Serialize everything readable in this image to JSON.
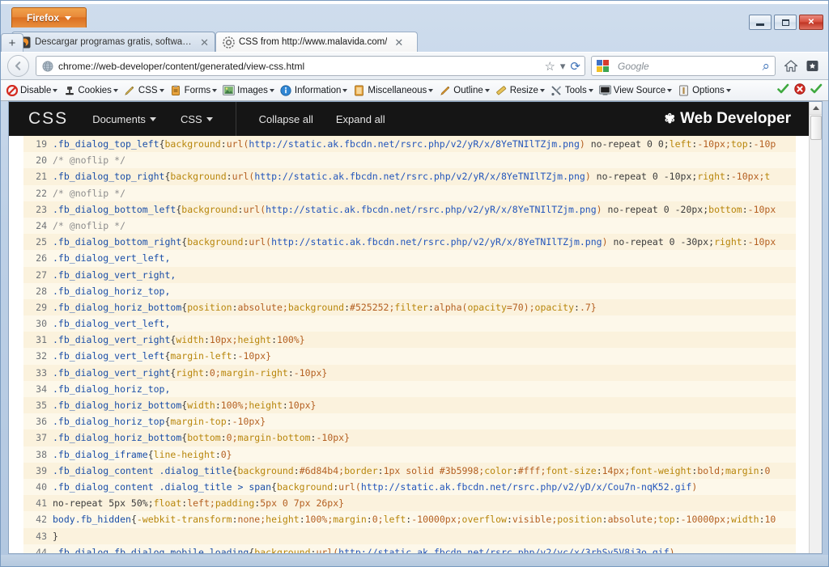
{
  "window": {
    "app_button": "Firefox",
    "controls": {
      "minimize": "minimize-icon",
      "maximize": "maximize-icon",
      "close": "✕"
    }
  },
  "tabs": [
    {
      "title": "Descargar programas gratis, software ...",
      "favicon": "firefox-favicon",
      "close": "✕",
      "active": false
    },
    {
      "title": "CSS from http://www.malavida.com/",
      "favicon": "gear-favicon",
      "close": "✕",
      "active": true
    }
  ],
  "newtab_label": "+",
  "navbar": {
    "back_glyph": "‹",
    "url": "chrome://web-developer/content/generated/view-css.html",
    "site_icon": "globe-icon",
    "star_icon": "☆",
    "dropmarker_icon": "▾",
    "reload_icon": "⟳",
    "search_engine": "Google",
    "search_glyph": "⌕",
    "home_icon": "home-icon",
    "bookmarks_icon": "bookmarks-icon",
    "bookmarks_caret": "▾"
  },
  "wd_toolbar": {
    "items": [
      {
        "label": "Disable",
        "icon": "disable-icon",
        "caret": "▾"
      },
      {
        "label": "Cookies",
        "icon": "cookies-icon",
        "caret": "▾"
      },
      {
        "label": "CSS",
        "icon": "css-pencil-icon",
        "caret": "▾"
      },
      {
        "label": "Forms",
        "icon": "forms-icon",
        "caret": "▾"
      },
      {
        "label": "Images",
        "icon": "images-icon",
        "caret": "▾"
      },
      {
        "label": "Information",
        "icon": "information-icon",
        "caret": "▾"
      },
      {
        "label": "Miscellaneous",
        "icon": "miscellaneous-icon",
        "caret": "▾"
      },
      {
        "label": "Outline",
        "icon": "outline-pencil-icon",
        "caret": "▾"
      },
      {
        "label": "Resize",
        "icon": "resize-ruler-icon",
        "caret": "▾"
      },
      {
        "label": "Tools",
        "icon": "tools-icon",
        "caret": "▾"
      },
      {
        "label": "View Source",
        "icon": "view-source-icon",
        "caret": "▾"
      },
      {
        "label": "Options",
        "icon": "options-icon",
        "caret": "▾"
      }
    ],
    "status": [
      {
        "icon": "validate-check-icon",
        "state": "ok"
      },
      {
        "icon": "validate-error-icon",
        "state": "error"
      },
      {
        "icon": "validate-check-icon",
        "state": "ok"
      }
    ]
  },
  "css_page": {
    "brand": "CSS",
    "menus": [
      {
        "label": "Documents",
        "caret": "▾"
      },
      {
        "label": "CSS",
        "caret": "▾"
      }
    ],
    "links": [
      "Collapse all",
      "Expand all"
    ],
    "wd_title": "Web Developer",
    "wd_gear": "✾"
  },
  "code": {
    "lines": [
      {
        "n": "19",
        "parts": [
          {
            "t": ".fb_dialog_top_left",
            "c": "sel"
          },
          {
            "t": "{",
            "c": "punct"
          },
          {
            "t": "background",
            "c": "prop"
          },
          {
            "t": ":",
            "c": "punct"
          },
          {
            "t": "url(",
            "c": "val"
          },
          {
            "t": "http://static.ak.fbcdn.net/rsrc.php/v2/yR/x/8YeTNIlTZjm.png",
            "c": "url"
          },
          {
            "t": ")",
            "c": "val"
          },
          {
            "t": " no-repeat 0 0;",
            "c": "punct"
          },
          {
            "t": "left",
            "c": "prop"
          },
          {
            "t": ":",
            "c": "punct"
          },
          {
            "t": "-10px;",
            "c": "val"
          },
          {
            "t": "top",
            "c": "prop"
          },
          {
            "t": ":",
            "c": "punct"
          },
          {
            "t": "-10p",
            "c": "val"
          }
        ]
      },
      {
        "n": "20",
        "parts": [
          {
            "t": "/* @noflip */",
            "c": "cmt"
          }
        ]
      },
      {
        "n": "21",
        "parts": [
          {
            "t": ".fb_dialog_top_right",
            "c": "sel"
          },
          {
            "t": "{",
            "c": "punct"
          },
          {
            "t": "background",
            "c": "prop"
          },
          {
            "t": ":",
            "c": "punct"
          },
          {
            "t": "url(",
            "c": "val"
          },
          {
            "t": "http://static.ak.fbcdn.net/rsrc.php/v2/yR/x/8YeTNIlTZjm.png",
            "c": "url"
          },
          {
            "t": ")",
            "c": "val"
          },
          {
            "t": " no-repeat 0 -10px;",
            "c": "punct"
          },
          {
            "t": "right",
            "c": "prop"
          },
          {
            "t": ":",
            "c": "punct"
          },
          {
            "t": "-10px;",
            "c": "val"
          },
          {
            "t": "t",
            "c": "prop"
          }
        ]
      },
      {
        "n": "22",
        "parts": [
          {
            "t": "/* @noflip */",
            "c": "cmt"
          }
        ]
      },
      {
        "n": "23",
        "parts": [
          {
            "t": ".fb_dialog_bottom_left",
            "c": "sel"
          },
          {
            "t": "{",
            "c": "punct"
          },
          {
            "t": "background",
            "c": "prop"
          },
          {
            "t": ":",
            "c": "punct"
          },
          {
            "t": "url(",
            "c": "val"
          },
          {
            "t": "http://static.ak.fbcdn.net/rsrc.php/v2/yR/x/8YeTNIlTZjm.png",
            "c": "url"
          },
          {
            "t": ")",
            "c": "val"
          },
          {
            "t": " no-repeat 0 -20px;",
            "c": "punct"
          },
          {
            "t": "bottom",
            "c": "prop"
          },
          {
            "t": ":",
            "c": "punct"
          },
          {
            "t": "-10px",
            "c": "val"
          }
        ]
      },
      {
        "n": "24",
        "parts": [
          {
            "t": "/* @noflip */",
            "c": "cmt"
          }
        ]
      },
      {
        "n": "25",
        "parts": [
          {
            "t": ".fb_dialog_bottom_right",
            "c": "sel"
          },
          {
            "t": "{",
            "c": "punct"
          },
          {
            "t": "background",
            "c": "prop"
          },
          {
            "t": ":",
            "c": "punct"
          },
          {
            "t": "url(",
            "c": "val"
          },
          {
            "t": "http://static.ak.fbcdn.net/rsrc.php/v2/yR/x/8YeTNIlTZjm.png",
            "c": "url"
          },
          {
            "t": ")",
            "c": "val"
          },
          {
            "t": " no-repeat 0 -30px;",
            "c": "punct"
          },
          {
            "t": "right",
            "c": "prop"
          },
          {
            "t": ":",
            "c": "punct"
          },
          {
            "t": "-10px",
            "c": "val"
          }
        ]
      },
      {
        "n": "26",
        "parts": [
          {
            "t": ".fb_dialog_vert_left,",
            "c": "sel"
          }
        ]
      },
      {
        "n": "27",
        "parts": [
          {
            "t": ".fb_dialog_vert_right,",
            "c": "sel"
          }
        ]
      },
      {
        "n": "28",
        "parts": [
          {
            "t": ".fb_dialog_horiz_top,",
            "c": "sel"
          }
        ]
      },
      {
        "n": "29",
        "parts": [
          {
            "t": ".fb_dialog_horiz_bottom",
            "c": "sel"
          },
          {
            "t": "{",
            "c": "punct"
          },
          {
            "t": "position",
            "c": "prop"
          },
          {
            "t": ":",
            "c": "punct"
          },
          {
            "t": "absolute;",
            "c": "val"
          },
          {
            "t": "background",
            "c": "prop"
          },
          {
            "t": ":",
            "c": "punct"
          },
          {
            "t": "#525252;",
            "c": "val"
          },
          {
            "t": "filter",
            "c": "prop"
          },
          {
            "t": ":",
            "c": "punct"
          },
          {
            "t": "alpha(",
            "c": "val"
          },
          {
            "t": "opacity",
            "c": "prop"
          },
          {
            "t": "=70);",
            "c": "val"
          },
          {
            "t": "opacity",
            "c": "prop"
          },
          {
            "t": ":",
            "c": "punct"
          },
          {
            "t": ".7}",
            "c": "val"
          }
        ]
      },
      {
        "n": "30",
        "parts": [
          {
            "t": ".fb_dialog_vert_left,",
            "c": "sel"
          }
        ]
      },
      {
        "n": "31",
        "parts": [
          {
            "t": ".fb_dialog_vert_right",
            "c": "sel"
          },
          {
            "t": "{",
            "c": "punct"
          },
          {
            "t": "width",
            "c": "prop"
          },
          {
            "t": ":",
            "c": "punct"
          },
          {
            "t": "10px;",
            "c": "val"
          },
          {
            "t": "height",
            "c": "prop"
          },
          {
            "t": ":",
            "c": "punct"
          },
          {
            "t": "100%}",
            "c": "val"
          }
        ]
      },
      {
        "n": "32",
        "parts": [
          {
            "t": ".fb_dialog_vert_left",
            "c": "sel"
          },
          {
            "t": "{",
            "c": "punct"
          },
          {
            "t": "margin-left",
            "c": "prop"
          },
          {
            "t": ":",
            "c": "punct"
          },
          {
            "t": "-10px}",
            "c": "val"
          }
        ]
      },
      {
        "n": "33",
        "parts": [
          {
            "t": ".fb_dialog_vert_right",
            "c": "sel"
          },
          {
            "t": "{",
            "c": "punct"
          },
          {
            "t": "right",
            "c": "prop"
          },
          {
            "t": ":",
            "c": "punct"
          },
          {
            "t": "0;",
            "c": "val"
          },
          {
            "t": "margin-right",
            "c": "prop"
          },
          {
            "t": ":",
            "c": "punct"
          },
          {
            "t": "-10px}",
            "c": "val"
          }
        ]
      },
      {
        "n": "34",
        "parts": [
          {
            "t": ".fb_dialog_horiz_top,",
            "c": "sel"
          }
        ]
      },
      {
        "n": "35",
        "parts": [
          {
            "t": ".fb_dialog_horiz_bottom",
            "c": "sel"
          },
          {
            "t": "{",
            "c": "punct"
          },
          {
            "t": "width",
            "c": "prop"
          },
          {
            "t": ":",
            "c": "punct"
          },
          {
            "t": "100%;",
            "c": "val"
          },
          {
            "t": "height",
            "c": "prop"
          },
          {
            "t": ":",
            "c": "punct"
          },
          {
            "t": "10px}",
            "c": "val"
          }
        ]
      },
      {
        "n": "36",
        "parts": [
          {
            "t": ".fb_dialog_horiz_top",
            "c": "sel"
          },
          {
            "t": "{",
            "c": "punct"
          },
          {
            "t": "margin-top",
            "c": "prop"
          },
          {
            "t": ":",
            "c": "punct"
          },
          {
            "t": "-10px}",
            "c": "val"
          }
        ]
      },
      {
        "n": "37",
        "parts": [
          {
            "t": ".fb_dialog_horiz_bottom",
            "c": "sel"
          },
          {
            "t": "{",
            "c": "punct"
          },
          {
            "t": "bottom",
            "c": "prop"
          },
          {
            "t": ":",
            "c": "punct"
          },
          {
            "t": "0;",
            "c": "val"
          },
          {
            "t": "margin-bottom",
            "c": "prop"
          },
          {
            "t": ":",
            "c": "punct"
          },
          {
            "t": "-10px}",
            "c": "val"
          }
        ]
      },
      {
        "n": "38",
        "parts": [
          {
            "t": ".fb_dialog_iframe",
            "c": "sel"
          },
          {
            "t": "{",
            "c": "punct"
          },
          {
            "t": "line-height",
            "c": "prop"
          },
          {
            "t": ":",
            "c": "punct"
          },
          {
            "t": "0}",
            "c": "val"
          }
        ]
      },
      {
        "n": "39",
        "parts": [
          {
            "t": ".fb_dialog_content .dialog_title",
            "c": "sel"
          },
          {
            "t": "{",
            "c": "punct"
          },
          {
            "t": "background",
            "c": "prop"
          },
          {
            "t": ":",
            "c": "punct"
          },
          {
            "t": "#6d84b4;",
            "c": "val"
          },
          {
            "t": "border",
            "c": "prop"
          },
          {
            "t": ":",
            "c": "punct"
          },
          {
            "t": "1px solid #3b5998;",
            "c": "val"
          },
          {
            "t": "color",
            "c": "prop"
          },
          {
            "t": ":",
            "c": "punct"
          },
          {
            "t": "#fff;",
            "c": "val"
          },
          {
            "t": "font-size",
            "c": "prop"
          },
          {
            "t": ":",
            "c": "punct"
          },
          {
            "t": "14px;",
            "c": "val"
          },
          {
            "t": "font-weight",
            "c": "prop"
          },
          {
            "t": ":",
            "c": "punct"
          },
          {
            "t": "bold;",
            "c": "val"
          },
          {
            "t": "margin",
            "c": "prop"
          },
          {
            "t": ":",
            "c": "punct"
          },
          {
            "t": "0",
            "c": "val"
          }
        ]
      },
      {
        "n": "40",
        "parts": [
          {
            "t": ".fb_dialog_content .dialog_title > span",
            "c": "sel"
          },
          {
            "t": "{",
            "c": "punct"
          },
          {
            "t": "background",
            "c": "prop"
          },
          {
            "t": ":",
            "c": "punct"
          },
          {
            "t": "url(",
            "c": "val"
          },
          {
            "t": "http://static.ak.fbcdn.net/rsrc.php/v2/yD/x/Cou7n-nqK52.gif",
            "c": "url"
          },
          {
            "t": ")",
            "c": "val"
          }
        ]
      },
      {
        "n": "41",
        "parts": [
          {
            "t": "no-repeat 5px 50%;",
            "c": "punct"
          },
          {
            "t": "float",
            "c": "prop"
          },
          {
            "t": ":",
            "c": "punct"
          },
          {
            "t": "left;",
            "c": "val"
          },
          {
            "t": "padding",
            "c": "prop"
          },
          {
            "t": ":",
            "c": "punct"
          },
          {
            "t": "5px 0 7px 26px}",
            "c": "val"
          }
        ]
      },
      {
        "n": "42",
        "parts": [
          {
            "t": "body.fb_hidden",
            "c": "sel"
          },
          {
            "t": "{",
            "c": "punct"
          },
          {
            "t": "-webkit-transform",
            "c": "prop"
          },
          {
            "t": ":",
            "c": "punct"
          },
          {
            "t": "none;",
            "c": "val"
          },
          {
            "t": "height",
            "c": "prop"
          },
          {
            "t": ":",
            "c": "punct"
          },
          {
            "t": "100%;",
            "c": "val"
          },
          {
            "t": "margin",
            "c": "prop"
          },
          {
            "t": ":",
            "c": "punct"
          },
          {
            "t": "0;",
            "c": "val"
          },
          {
            "t": "left",
            "c": "prop"
          },
          {
            "t": ":",
            "c": "punct"
          },
          {
            "t": "-10000px;",
            "c": "val"
          },
          {
            "t": "overflow",
            "c": "prop"
          },
          {
            "t": ":",
            "c": "punct"
          },
          {
            "t": "visible;",
            "c": "val"
          },
          {
            "t": "position",
            "c": "prop"
          },
          {
            "t": ":",
            "c": "punct"
          },
          {
            "t": "absolute;",
            "c": "val"
          },
          {
            "t": "top",
            "c": "prop"
          },
          {
            "t": ":",
            "c": "punct"
          },
          {
            "t": "-10000px;",
            "c": "val"
          },
          {
            "t": "width",
            "c": "prop"
          },
          {
            "t": ":",
            "c": "punct"
          },
          {
            "t": "10",
            "c": "val"
          }
        ]
      },
      {
        "n": "43",
        "parts": [
          {
            "t": "}",
            "c": "punct"
          }
        ]
      },
      {
        "n": "44",
        "parts": [
          {
            "t": ".fb_dialog.fb_dialog_mobile.loading",
            "c": "sel"
          },
          {
            "t": "{",
            "c": "punct"
          },
          {
            "t": "background",
            "c": "prop"
          },
          {
            "t": ":",
            "c": "punct"
          },
          {
            "t": "url(",
            "c": "val"
          },
          {
            "t": "http://static.ak.fbcdn.net/rsrc.php/v2/yc/x/3rhSv5V8j3o.gif",
            "c": "url"
          },
          {
            "t": ")",
            "c": "val"
          }
        ]
      }
    ]
  },
  "scrollbar": {
    "up_glyph": "▲"
  },
  "colors": {
    "code_bg_odd": "#fbf2dd",
    "code_bg_even": "#fdf8ea",
    "header_bg": "#151515",
    "selector": "#1a4ea8",
    "property": "#b8860b",
    "value": "#b45f20",
    "url": "#2255bb",
    "comment": "#8d8d8d",
    "firefox_orange": "#db6f21"
  }
}
